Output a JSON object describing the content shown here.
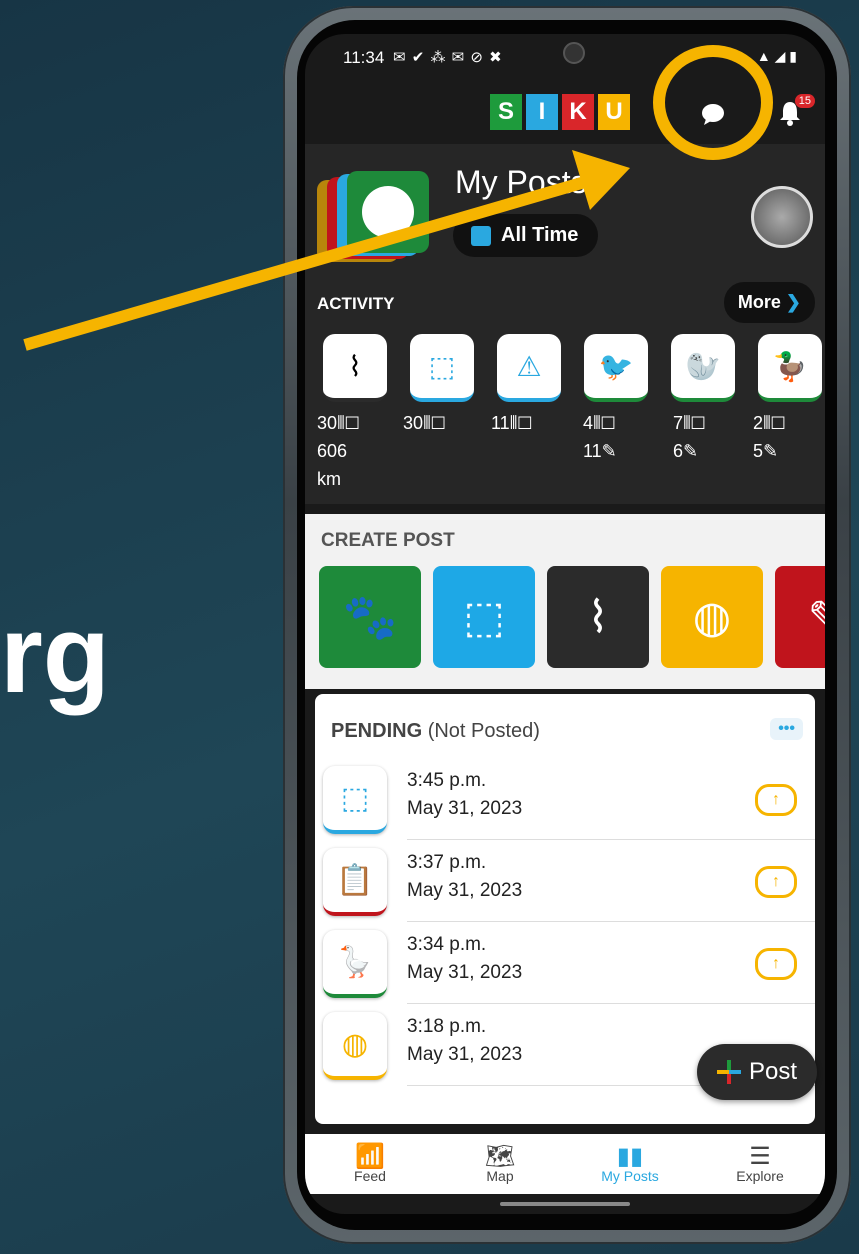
{
  "side_text": "rg",
  "statusbar": {
    "time": "11:34",
    "icons": "✉ ✔ ⁂ ✉ ⊘ ✖",
    "right": "▲ ◢ ▮"
  },
  "logo": {
    "letters": [
      "S",
      "I",
      "K",
      "U"
    ],
    "colors": [
      "#1e9b3c",
      "#2aa8e0",
      "#d9262a",
      "#f6b400"
    ]
  },
  "topbar": {
    "notification_count": "15"
  },
  "header": {
    "title": "My Posts",
    "period": "All Time"
  },
  "activity": {
    "label": "ACTIVITY",
    "more_label": "More",
    "items": [
      {
        "icon": "route-icon",
        "line1": "30⦀☐",
        "line2": "606",
        "line3": "km"
      },
      {
        "icon": "ice-blocks-icon",
        "line1": "30⦀☐",
        "line2": "",
        "line3": ""
      },
      {
        "icon": "ice-warning-icon",
        "line1": "11⦀☐",
        "line2": "",
        "line3": ""
      },
      {
        "icon": "ptarmigan-icon",
        "line1": "4⦀☐",
        "line2": "11✎",
        "line3": ""
      },
      {
        "icon": "seal-icon",
        "line1": "7⦀☐",
        "line2": "6✎",
        "line3": ""
      },
      {
        "icon": "eider-duck-icon",
        "line1": "2⦀☐",
        "line2": "5✎",
        "line3": ""
      }
    ]
  },
  "create": {
    "label": "CREATE POST",
    "tiles": [
      {
        "icon": "paw-icon",
        "glyph": "🐾",
        "color": "#1e8a3a"
      },
      {
        "icon": "ice-blocks-icon",
        "glyph": "⬚",
        "color": "#1ea8e6"
      },
      {
        "icon": "route-icon",
        "glyph": "⌇",
        "color": "#2b2b2b"
      },
      {
        "icon": "person-icon",
        "glyph": "◍",
        "color": "#f6b400"
      },
      {
        "icon": "tool-icon",
        "glyph": "✎",
        "color": "#c0141c"
      }
    ]
  },
  "pending": {
    "label": "PENDING",
    "sub": "(Not Posted)",
    "more": "•••",
    "items": [
      {
        "icon": "ice-blocks-icon",
        "glyph": "⬚",
        "accent": "#2aa8e0",
        "time": "3:45 p.m.",
        "date": "May 31, 2023"
      },
      {
        "icon": "clipboard-icon",
        "glyph": "📋",
        "accent": "#c0141c",
        "time": "3:37 p.m.",
        "date": "May 31, 2023"
      },
      {
        "icon": "goose-icon",
        "glyph": "🪿",
        "accent": "#1e8a3a",
        "time": "3:34 p.m.",
        "date": "May 31, 2023"
      },
      {
        "icon": "person-icon",
        "glyph": "◍",
        "accent": "#f6b400",
        "time": "3:18 p.m.",
        "date": "May 31, 2023"
      }
    ]
  },
  "fab": {
    "label": "Post"
  },
  "nav": [
    {
      "label": "Feed",
      "icon": "feed-icon",
      "glyph": "📶"
    },
    {
      "label": "Map",
      "icon": "map-icon",
      "glyph": "🗺"
    },
    {
      "label": "My Posts",
      "icon": "my-posts-icon",
      "glyph": "▮▮"
    },
    {
      "label": "Explore",
      "icon": "menu-icon",
      "glyph": "☰"
    }
  ]
}
